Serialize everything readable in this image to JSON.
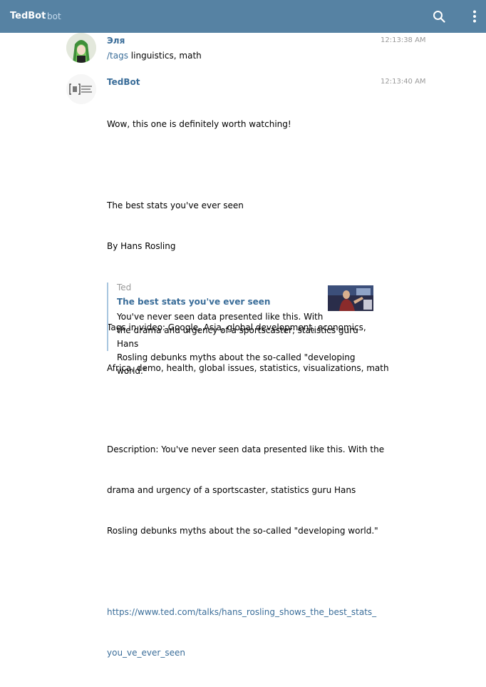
{
  "header": {
    "title": "TedBot",
    "subtitle": "bot",
    "search_icon": "search-icon",
    "menu_icon": "more-vertical-icon",
    "bg_color": "#5682a3"
  },
  "messages": [
    {
      "author": "Эля",
      "time": "12:13:38 AM",
      "command": "/tags",
      "text": " linguistics, math"
    },
    {
      "author": "TedBot",
      "time": "12:13:40 AM",
      "lines": [
        "Wow, this one is definitely worth watching!",
        "",
        "The best stats you've ever seen",
        "By Hans Rosling",
        "",
        "Tags in video: Google, Asia, global development, economics,",
        "Africa, demo, health, global issues, statistics, visualizations, math",
        "",
        "Description: You've never seen data presented like this. With the",
        "drama and urgency of a sportscaster, statistics guru Hans",
        "Rosling debunks myths about the so-called \"developing world.\""
      ],
      "link_line1": "https://www.ted.com/talks/hans_rosling_shows_the_best_stats_",
      "link_line2": "you_ve_ever_seen",
      "preview": {
        "site": "Ted",
        "title": "The best stats you've ever seen",
        "desc_lines": [
          "You've never seen data presented like this. With",
          "the drama and urgency of a sportscaster, statistics guru Hans",
          "Rosling debunks myths about the so-called \"developing world.\""
        ]
      }
    }
  ],
  "colors": {
    "link": "#3a6d99",
    "time": "#999999",
    "quote_bar": "#a8c5df"
  }
}
